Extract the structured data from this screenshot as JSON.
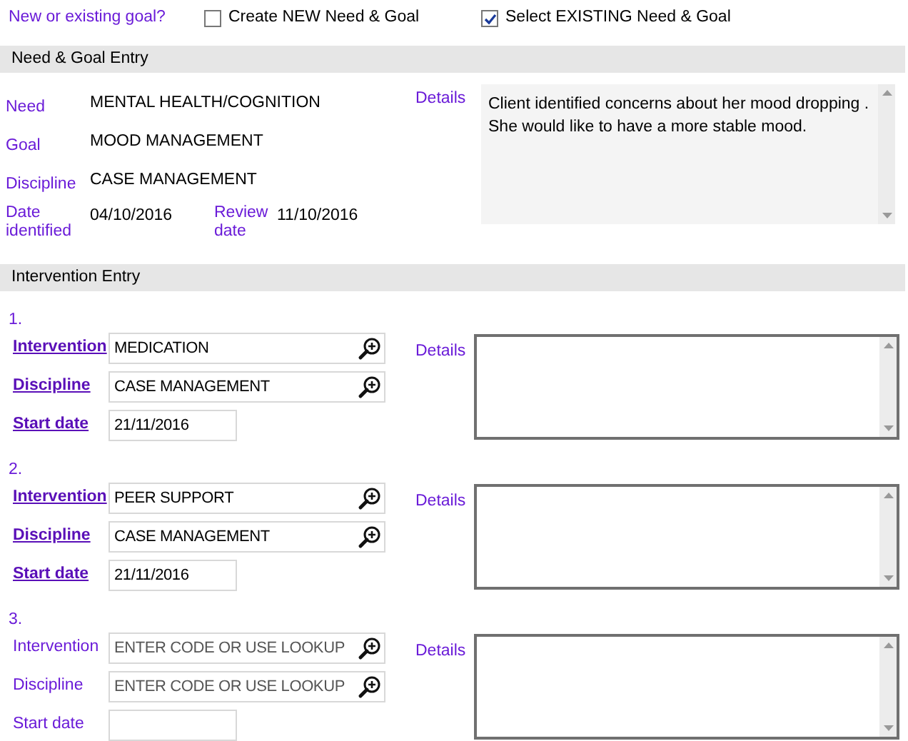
{
  "goal_choice": {
    "label": "New or existing goal?",
    "options": [
      {
        "label": "Create NEW Need & Goal",
        "checked": false
      },
      {
        "label": "Select EXISTING Need & Goal",
        "checked": true
      }
    ]
  },
  "need_goal": {
    "title": "Need & Goal Entry",
    "fields": [
      {
        "label": "Need",
        "value": "MENTAL HEALTH/COGNITION"
      },
      {
        "label": "Goal",
        "value": "MOOD MANAGEMENT"
      },
      {
        "label": "Discipline",
        "value": "CASE MANAGEMENT"
      }
    ],
    "date_identified": {
      "label": "Date identified",
      "value": "04/10/2016"
    },
    "review_date": {
      "label": "Review date",
      "value": "11/10/2016"
    },
    "details": {
      "label": "Details",
      "value": "Client identified concerns about her mood dropping . She would like to have a more stable mood."
    }
  },
  "interventions_title": "Intervention Entry",
  "interventions": [
    {
      "number": "1.",
      "linked": true,
      "intervention": {
        "label": "Intervention",
        "value": "MEDICATION"
      },
      "discipline": {
        "label": "Discipline",
        "value": "CASE MANAGEMENT"
      },
      "start_date": {
        "label": "Start date",
        "value": "21/11/2016"
      },
      "details_label": "Details"
    },
    {
      "number": "2.",
      "linked": true,
      "intervention": {
        "label": "Intervention",
        "value": "PEER SUPPORT"
      },
      "discipline": {
        "label": "Discipline",
        "value": "CASE MANAGEMENT"
      },
      "start_date": {
        "label": "Start date",
        "value": "21/11/2016"
      },
      "details_label": "Details"
    },
    {
      "number": "3.",
      "linked": false,
      "intervention": {
        "label": "Intervention",
        "placeholder": "ENTER CODE OR USE LOOKUP"
      },
      "discipline": {
        "label": "Discipline",
        "placeholder": "ENTER CODE OR USE LOOKUP"
      },
      "start_date": {
        "label": "Start date"
      },
      "details_label": "Details"
    }
  ]
}
